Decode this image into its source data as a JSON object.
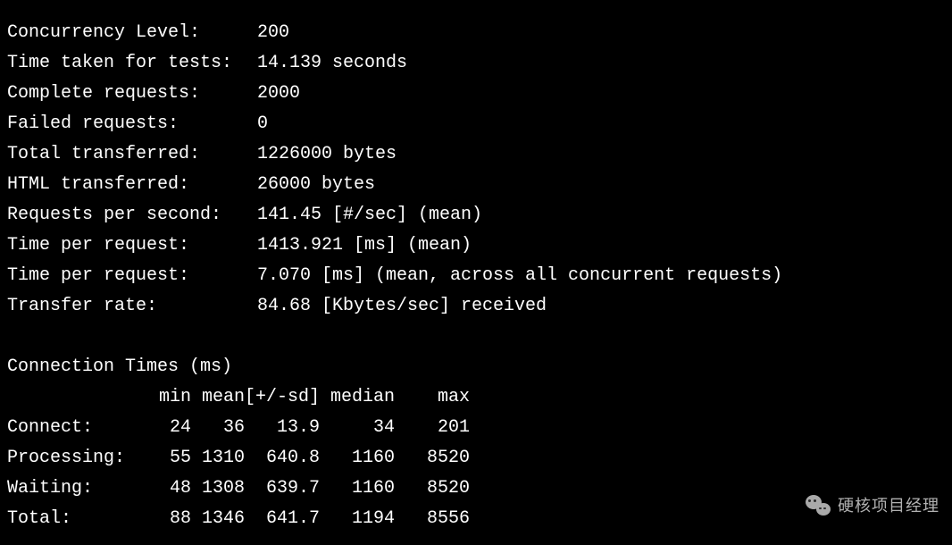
{
  "summary": [
    {
      "label": "Concurrency Level:",
      "value": "200"
    },
    {
      "label": "Time taken for tests:",
      "value": "14.139 seconds"
    },
    {
      "label": "Complete requests:",
      "value": "2000"
    },
    {
      "label": "Failed requests:",
      "value": "0"
    },
    {
      "label": "Total transferred:",
      "value": "1226000 bytes"
    },
    {
      "label": "HTML transferred:",
      "value": "26000 bytes"
    },
    {
      "label": "Requests per second:",
      "value": "141.45 [#/sec] (mean)"
    },
    {
      "label": "Time per request:",
      "value": "1413.921 [ms] (mean)"
    },
    {
      "label": "Time per request:",
      "value": "7.070 [ms] (mean, across all concurrent requests)"
    },
    {
      "label": "Transfer rate:",
      "value": "84.68 [Kbytes/sec] received"
    }
  ],
  "connection_times": {
    "header": "Connection Times (ms)",
    "columns": {
      "min": "min",
      "mean": "mean",
      "sd": "[+/-sd]",
      "median": "median",
      "max": "max"
    },
    "rows": [
      {
        "label": "Connect:",
        "min": "24",
        "mean": "36",
        "sd": "13.9",
        "median": "34",
        "max": "201"
      },
      {
        "label": "Processing:",
        "min": "55",
        "mean": "1310",
        "sd": "640.8",
        "median": "1160",
        "max": "8520"
      },
      {
        "label": "Waiting:",
        "min": "48",
        "mean": "1308",
        "sd": "639.7",
        "median": "1160",
        "max": "8520"
      },
      {
        "label": "Total:",
        "min": "88",
        "mean": "1346",
        "sd": "641.7",
        "median": "1194",
        "max": "8556"
      }
    ]
  },
  "watermark": "硬核项目经理"
}
